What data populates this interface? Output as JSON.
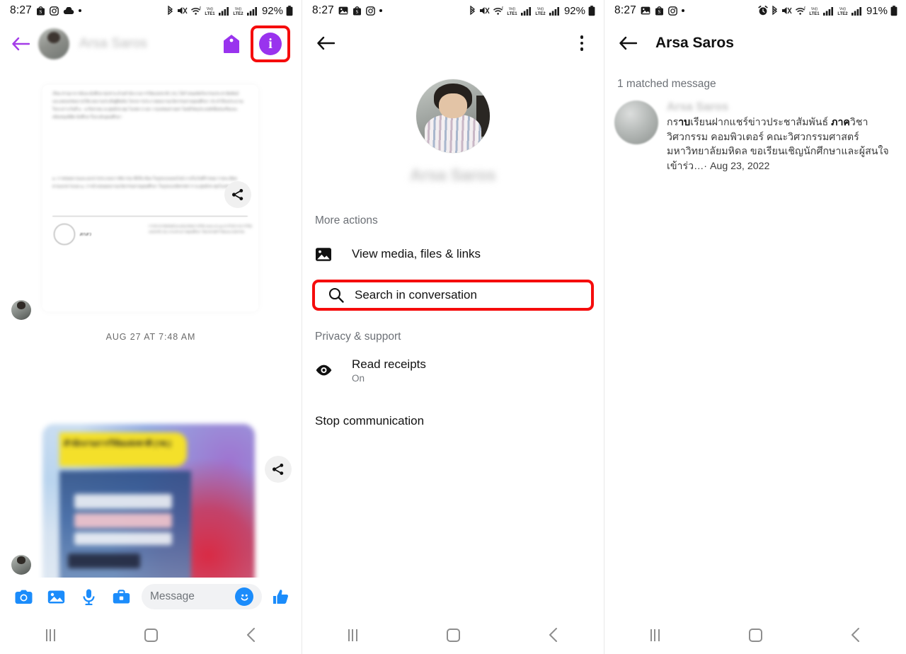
{
  "panel1": {
    "statusbar": {
      "time": "8:27",
      "left_icons": [
        "shopee-icon",
        "instagram-icon",
        "cloud-icon",
        "dot-icon"
      ],
      "right_icons": [
        "bluetooth-icon",
        "mute-icon",
        "wifi-icon",
        "volte-lte1-icon",
        "signal1-icon",
        "volte-lte2-icon",
        "signal2-icon"
      ],
      "battery": "92%"
    },
    "header": {
      "back_label": "back-arrow",
      "contact_name": "Arsa Saros",
      "tag_label": "tag",
      "info_label": "i"
    },
    "thread": {
      "daystamp": "AUG 27 AT 7:48 AM",
      "doc_footer_brand": "สกสว",
      "photo_banner_title": "สำนักงานการวิจัยแห่งชาติ (วช.)",
      "share_label": "share"
    },
    "composer": {
      "placeholder": "Message",
      "icons": [
        "camera-icon",
        "gallery-icon",
        "microphone-icon",
        "briefcase-icon",
        "emoji-icon",
        "thumbs-up-icon"
      ]
    },
    "navbar": {
      "recent": "recent-apps",
      "home": "home",
      "back": "back"
    }
  },
  "panel2": {
    "statusbar": {
      "time": "8:27",
      "left_icons": [
        "photo-icon",
        "shopee-icon",
        "instagram-icon",
        "dot-icon"
      ],
      "battery": "92%"
    },
    "header": {
      "back_label": "back-arrow",
      "menu_label": "more-options"
    },
    "profile": {
      "name": "Arsa Saros"
    },
    "sections": [
      {
        "label": "More actions",
        "items": [
          {
            "icon": "image-icon",
            "label": "View media, files & links",
            "sub": "",
            "highlighted": false
          },
          {
            "icon": "search-icon",
            "label": "Search in conversation",
            "sub": "",
            "highlighted": true
          }
        ]
      },
      {
        "label": "Privacy & support",
        "items": [
          {
            "icon": "eye-icon",
            "label": "Read receipts",
            "sub": "On",
            "highlighted": false
          }
        ]
      }
    ],
    "stop_communication": "Stop communication",
    "navbar": {
      "recent": "recent-apps",
      "home": "home",
      "back": "back"
    }
  },
  "panel3": {
    "statusbar": {
      "time": "8:27",
      "left_icons": [
        "photo-icon",
        "shopee-icon",
        "instagram-icon",
        "dot-icon"
      ],
      "right_icons": [
        "alarm-icon",
        "bluetooth-icon",
        "mute-icon",
        "wifi-icon",
        "volte-lte1-icon",
        "signal1-icon",
        "volte-lte2-icon",
        "signal2-icon"
      ],
      "battery": "91%"
    },
    "header": {
      "back_label": "back-arrow",
      "title": "Arsa Saros"
    },
    "results_label": "1 matched message",
    "result": {
      "sender": "Arsa Saros",
      "line1_pre": "กร",
      "line1_bold": "าบ",
      "line1_mid": "เรียนฝากแชร์ข่าวประชาสัมพันธ์ ",
      "line1_bold2": "ภาค",
      "line1_post": "วิชาวิศวกรรม",
      "line2": "คอมพิวเตอร์ คณะวิศวกรรมศาสตร์ มหาวิทยาลัยมหิดล",
      "line3": "ขอเรียนเชิญนักศึกษาและผู้สนใจเข้าร่ว…",
      "date": "· Aug 23, 2022"
    },
    "navbar": {
      "recent": "recent-apps",
      "home": "home",
      "back": "back"
    }
  },
  "colors": {
    "highlight_red": "#f50c0c",
    "messenger_blue": "#1b8cfb",
    "info_purple": "#9933ee",
    "banner_yellow": "#f4e02a"
  }
}
